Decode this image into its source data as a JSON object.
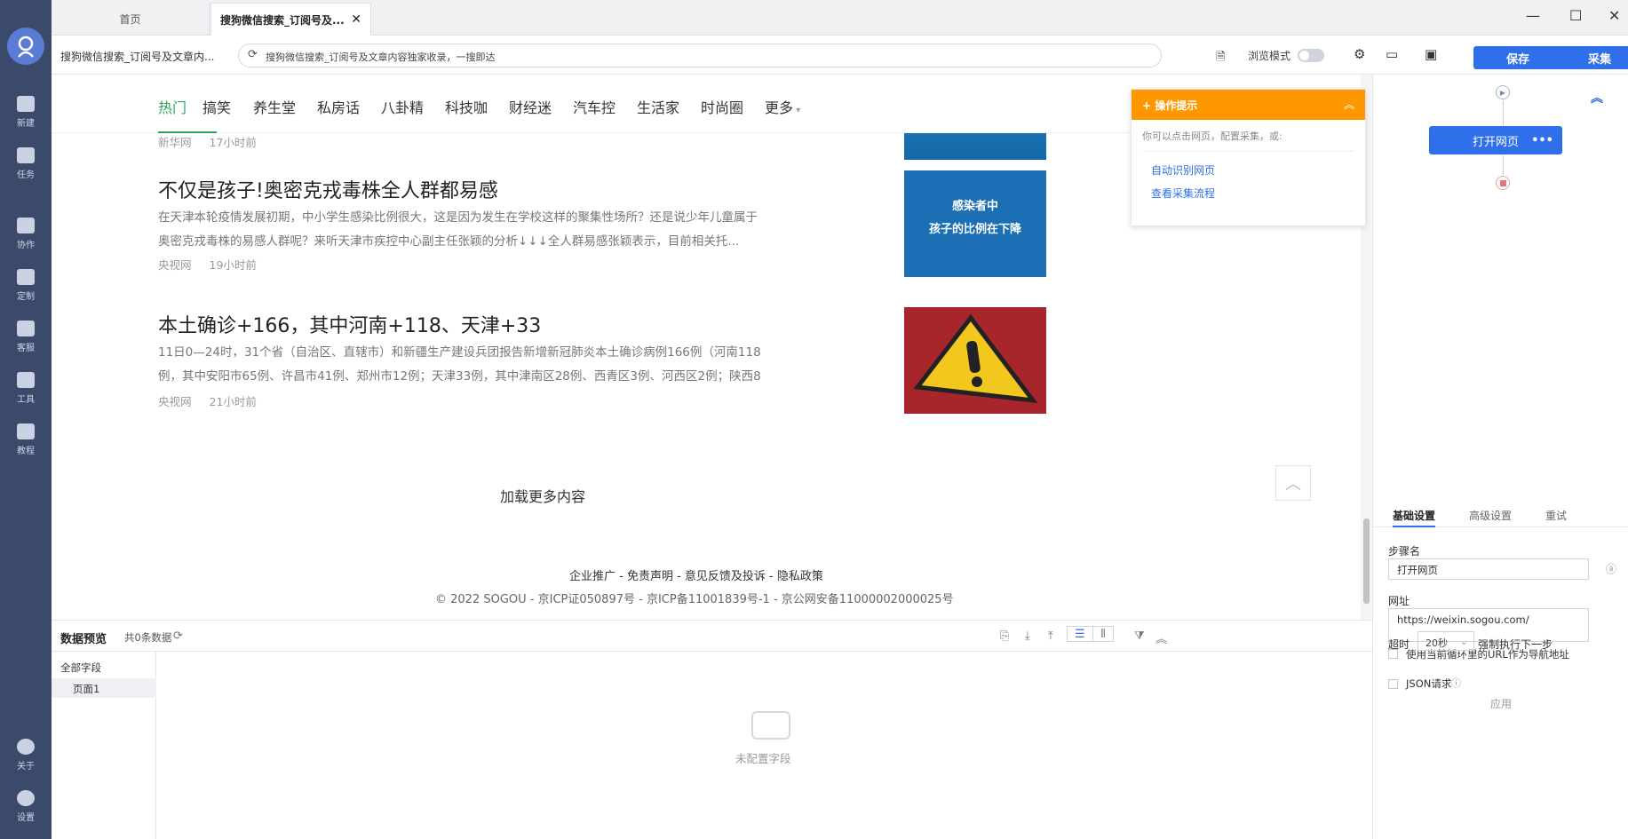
{
  "rail": {
    "items": [
      {
        "label": "新建",
        "icon": "plus-icon"
      },
      {
        "label": "任务",
        "icon": "bookmark-icon"
      },
      {
        "label": "协作",
        "icon": "users-icon"
      },
      {
        "label": "定制",
        "icon": "heart-icon"
      },
      {
        "label": "客服",
        "icon": "headset-icon"
      },
      {
        "label": "工具",
        "icon": "briefcase-icon"
      },
      {
        "label": "教程",
        "icon": "layers-icon"
      }
    ],
    "bottom": [
      {
        "label": "关于",
        "icon": "info-icon"
      },
      {
        "label": "设置",
        "icon": "gear-icon"
      }
    ]
  },
  "tabs": {
    "home": "首页",
    "active": "搜狗微信搜索_订阅号及...",
    "close": "✕"
  },
  "window": {
    "minimize": "—",
    "maximize": "☐",
    "close": "✕"
  },
  "address": {
    "page_title": "搜狗微信搜索_订阅号及文章内...",
    "url_text": "搜狗微信搜索_订阅号及文章内容独家收录，一搜即达",
    "browse_mode": "浏览模式",
    "save": "保存",
    "collect": "采集"
  },
  "nav": [
    "热门",
    "搞笑",
    "养生堂",
    "私房话",
    "八卦精",
    "科技咖",
    "财经迷",
    "汽车控",
    "生活家",
    "时尚圈",
    "更多"
  ],
  "articles": [
    {
      "title": "",
      "source": "新华网",
      "time": "17小时前"
    },
    {
      "title": "不仅是孩子!奥密克戎毒株全人群都易感",
      "desc1": "在天津本轮疫情发展初期，中小学生感染比例很大，这是因为发生在学校这样的聚集性场所？还是说少年儿童属于",
      "desc2": "奥密克戎毒株的易感人群呢？来听天津市疾控中心副主任张颖的分析↓↓↓全人群易感张颖表示，目前相关托...",
      "source": "央视网",
      "time": "19小时前",
      "thumb_text1": "感染者中",
      "thumb_text2": "孩子的比例在下降"
    },
    {
      "title": "本土确诊+166，其中河南+118、天津+33",
      "desc1": "11日0—24时，31个省（自治区、直辖市）和新疆生产建设兵团报告新增新冠肺炎本土确诊病例166例（河南118",
      "desc2": "例，其中安阳市65例、许昌市41例、郑州市12例；天津33例，其中津南区28例、西青区3例、河西区2例；陕西8",
      "source": "央视网",
      "time": "21小时前"
    }
  ],
  "load_more": "加载更多内容",
  "footer": {
    "links": "企业推广 - 免责声明 - 意见反馈及投诉 - 隐私政策",
    "copyright": "© 2022 SOGOU - 京ICP证050897号 - 京ICP备11001839号-1 - 京公网安备11000002000025号"
  },
  "hint": {
    "title": "操作提示",
    "text": "你可以点击网页，配置采集，或:",
    "link1": "自动识别网页",
    "link2": "查看采集流程"
  },
  "flow": {
    "node": "打开网页"
  },
  "panel": {
    "tabs": [
      "基础设置",
      "高级设置",
      "重试"
    ],
    "step_label": "步骤名",
    "step_value": "打开网页",
    "url_label": "网址",
    "url_value": "https://weixin.sogou.com/",
    "chk1": "使用当前循环里的URL作为导航地址",
    "chk2": "JSON请求",
    "timeout_label": "超时",
    "timeout_value": "20秒",
    "force_next": "强制执行下一步",
    "apply": "应用"
  },
  "preview": {
    "title": "数据预览",
    "count": "共0条数据",
    "all_fields": "全部字段",
    "page1": "页面1",
    "empty": "未配置字段"
  },
  "colors": {
    "accent": "#2f6fea",
    "green": "#2ea35a",
    "orange": "#ff9800",
    "rail": "#3b4a6b"
  }
}
